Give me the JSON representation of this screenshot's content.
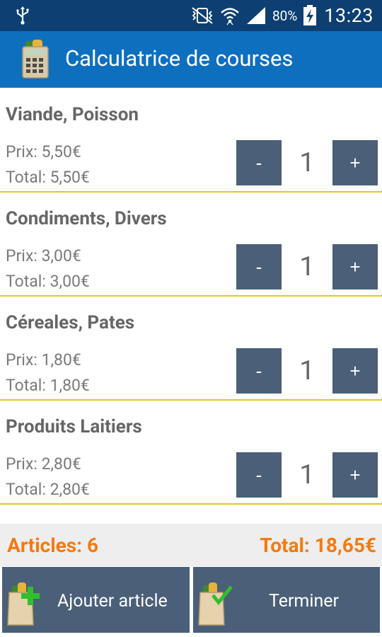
{
  "status_bar": {
    "battery_percent": "80%",
    "time": "13:23",
    "icons": [
      "usb-icon",
      "vibrate-mute-icon",
      "wifi-icon",
      "signal-icon",
      "battery-charging-icon"
    ]
  },
  "app": {
    "title": "Calculatrice de courses",
    "icon": "calculator-grocery-icon",
    "brand_color": "#0f6fbf",
    "status_color": "#0d3f72"
  },
  "items": [
    {
      "name": "Viande, Poisson",
      "price": "Prix: 5,50€",
      "total": "Total: 5,50€",
      "quantity": "1",
      "minus": "-",
      "plus": "+"
    },
    {
      "name": "Condiments, Divers",
      "price": "Prix: 3,00€",
      "total": "Total: 3,00€",
      "quantity": "1",
      "minus": "-",
      "plus": "+"
    },
    {
      "name": "Céreales, Pates",
      "price": "Prix: 1,80€",
      "total": "Total: 1,80€",
      "quantity": "1",
      "minus": "-",
      "plus": "+"
    },
    {
      "name": "Produits Laitiers",
      "price": "Prix: 2,80€",
      "total": "Total: 2,80€",
      "quantity": "1",
      "minus": "-",
      "plus": "+"
    }
  ],
  "summary": {
    "articles": "Articles: 6",
    "total": "Total: 18,65€",
    "accent_color": "#f47a10"
  },
  "actions": {
    "add_label": "Ajouter article",
    "finish_label": "Terminer",
    "button_color": "#4a5f78",
    "divider_color": "#f2c318"
  }
}
